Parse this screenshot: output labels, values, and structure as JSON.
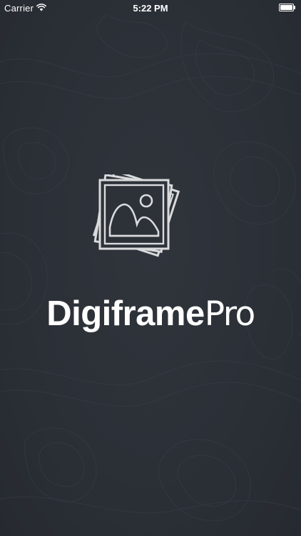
{
  "status_bar": {
    "carrier": "Carrier",
    "time": "5:22 PM",
    "battery_level": 1.0
  },
  "splash": {
    "brand_name": "Digiframe",
    "brand_suffix": "Pro",
    "logo_icon": "photo-stack-icon"
  },
  "colors": {
    "background": "#2b3037",
    "logo_stroke": "#d9dadc",
    "text": "#ffffff"
  }
}
